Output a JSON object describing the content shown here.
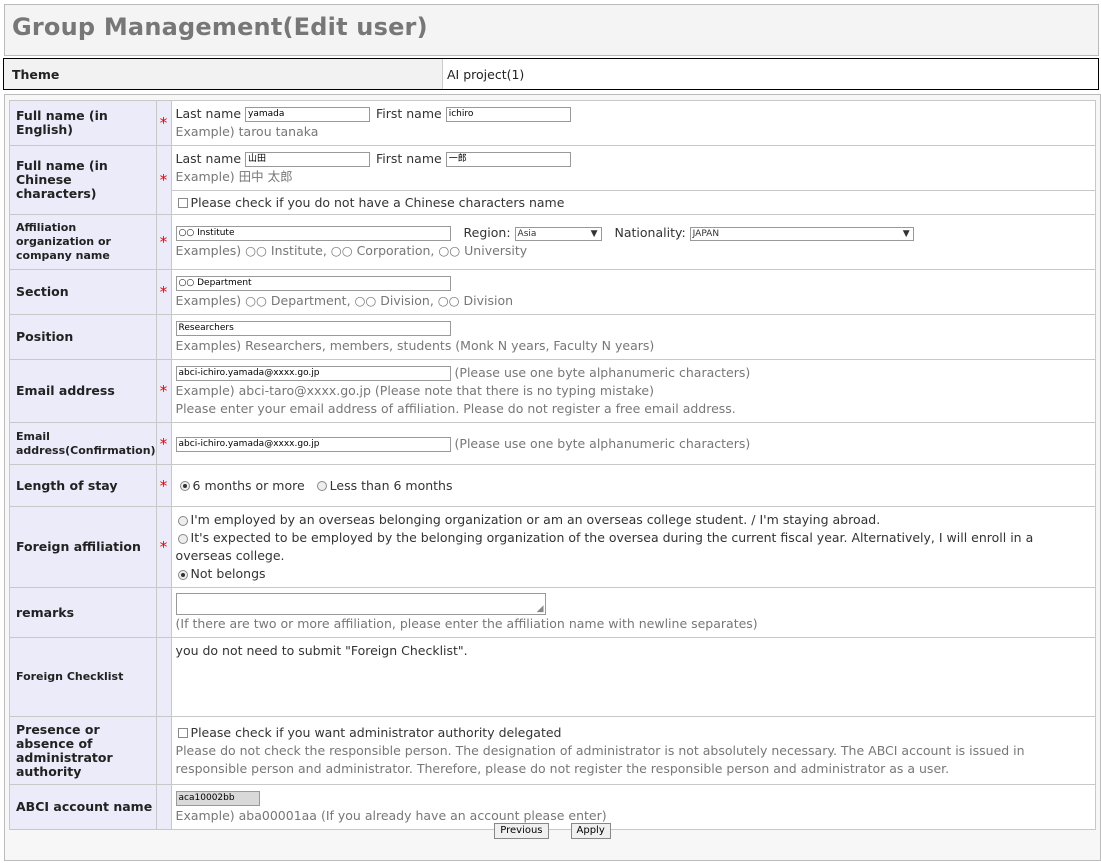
{
  "page_title": "Group Management(Edit user)",
  "theme": {
    "label": "Theme",
    "value": "AI project(1)"
  },
  "required_mark": "*",
  "fields": {
    "fullname_en": {
      "label": "Full name (in English)",
      "last_label": "Last name",
      "last_value": "yamada",
      "first_label": "First name",
      "first_value": "ichiro",
      "example": "Example) tarou tanaka"
    },
    "fullname_cn": {
      "label": "Full name (in Chinese characters)",
      "last_label": "Last name",
      "last_value": "山田",
      "first_label": "First name",
      "first_value": "一郎",
      "example": "Example) 田中 太郎",
      "no_chinese_check": "Please check if you do not have a Chinese characters name"
    },
    "affiliation": {
      "label": "Affiliation organization or company name",
      "value": "○○ Institute",
      "region_label": "Region:",
      "region_value": "Asia",
      "nationality_label": "Nationality:",
      "nationality_value": "JAPAN",
      "example": "Examples) ○○ Institute, ○○ Corporation, ○○ University"
    },
    "section": {
      "label": "Section",
      "value": "○○ Department",
      "example": "Examples) ○○ Department, ○○ Division, ○○ Division"
    },
    "position": {
      "label": "Position",
      "value": "Researchers",
      "example": "Examples) Researchers, members, students (Monk N years, Faculty N years)"
    },
    "email": {
      "label": "Email address",
      "value": "abci-ichiro.yamada@xxxx.go.jp",
      "note": "(Please use one byte alphanumeric characters)",
      "example": "Example) abci-taro@xxxx.go.jp (Please note that there is no typing mistake)",
      "note2": "Please enter your email address of affiliation. Please do not register a free email address."
    },
    "email_confirm": {
      "label": "Email address(Confirmation)",
      "value": "abci-ichiro.yamada@xxxx.go.jp",
      "note": "(Please use one byte alphanumeric characters)"
    },
    "stay": {
      "label": "Length of stay",
      "opt1": "6 months or more",
      "opt2": "Less than 6 months"
    },
    "foreign": {
      "label": "Foreign affiliation",
      "opt1": "I'm employed by an overseas belonging organization or am an overseas college student. / I'm staying abroad.",
      "opt2": "It's expected to be employed by the belonging organization of the oversea during the current fiscal year. Alternatively, I will enroll in a overseas college.",
      "opt3": "Not belongs"
    },
    "remarks": {
      "label": "remarks",
      "example": "(If there are two or more affiliation, please enter the affiliation name with newline separates)"
    },
    "checklist": {
      "label": "Foreign Checklist",
      "text": "you do not need to submit \"Foreign Checklist\"."
    },
    "admin": {
      "label": "Presence or absence of administrator authority",
      "check": "Please check if you want administrator authority delegated",
      "note": "Please do not check the responsible person. The designation of administrator is not absolutely necessary. The ABCI account is issued in responsible person and administrator. Therefore, please do not register the responsible person and administrator as a user."
    },
    "account": {
      "label": "ABCI account name",
      "value": "aca10002bb",
      "example": "Example) aba00001aa (If you already have an account please enter)"
    }
  },
  "buttons": {
    "previous": "Previous",
    "apply": "Apply"
  }
}
